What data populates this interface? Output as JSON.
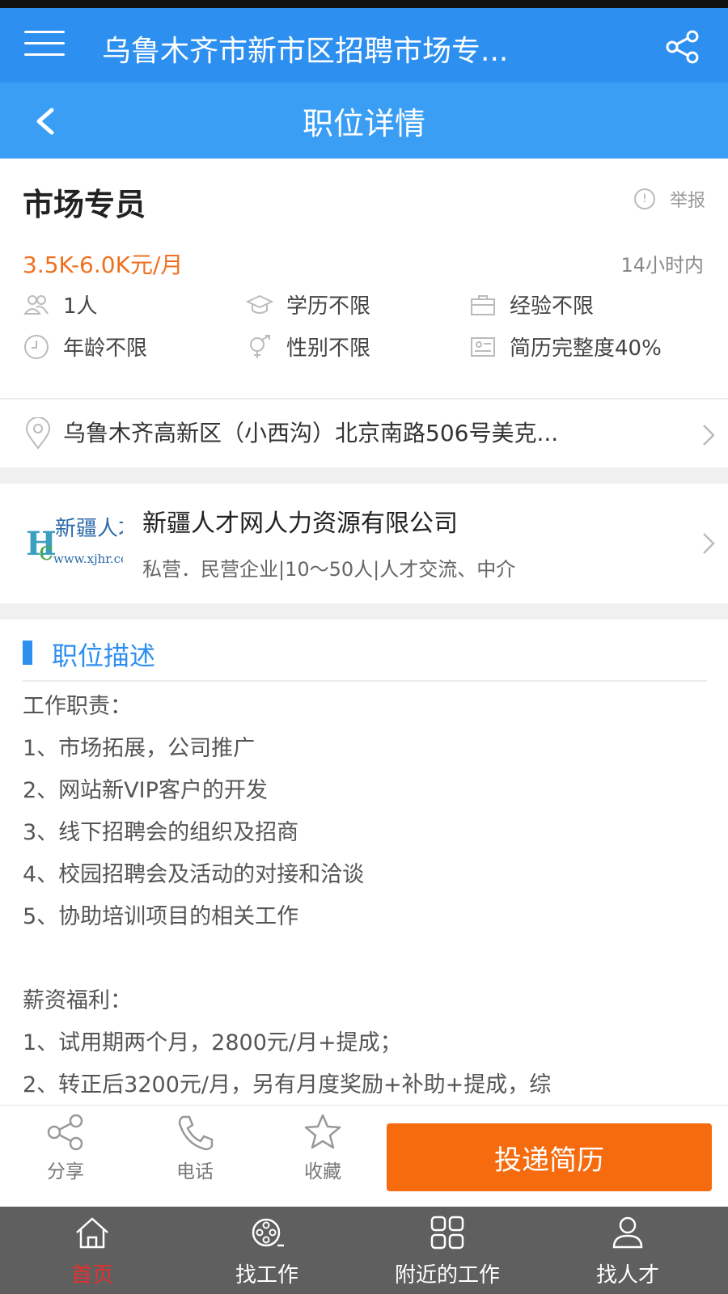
{
  "header": {
    "title": "乌鲁木齐市新市区招聘市场专...",
    "subtitle": "职位详情"
  },
  "job": {
    "title": "市场专员",
    "report_label": "举报",
    "salary": "3.5K-6.0K元/月",
    "posted": "14小时内",
    "attributes": [
      {
        "icon": "people-icon",
        "label": "1人"
      },
      {
        "icon": "graduation-cap-icon",
        "label": "学历不限"
      },
      {
        "icon": "briefcase-icon",
        "label": "经验不限"
      },
      {
        "icon": "clock-icon",
        "label": "年龄不限"
      },
      {
        "icon": "gender-icon",
        "label": "性别不限"
      },
      {
        "icon": "resume-card-icon",
        "label": "简历完整度40%"
      }
    ],
    "address": "乌鲁木齐高新区（小西沟）北京南路506号美克..."
  },
  "company": {
    "name": "新疆人才网人力资源有限公司",
    "info": "私营．民营企业|10～50人|人才交流、中介",
    "logo_text": "新疆人才网",
    "logo_url_text": "www.xjhr.com"
  },
  "description": {
    "heading": "职位描述",
    "lines": [
      "工作职责：",
      "1、市场拓展，公司推广",
      "2、网站新VIP客户的开发",
      "3、线下招聘会的组织及招商",
      "4、校园招聘会及活动的对接和洽谈",
      "5、协助培训项目的相关工作",
      "",
      "薪资福利：",
      "1、试用期两个月，2800元/月+提成；",
      "2、转正后3200元/月，另有月度奖励+补助+提成，综"
    ]
  },
  "actions": {
    "share": "分享",
    "phone": "电话",
    "favorite": "收藏",
    "apply": "投递简历"
  },
  "tabs": [
    {
      "label": "首页",
      "icon": "home-icon",
      "active": true
    },
    {
      "label": "找工作",
      "icon": "film-reel-icon",
      "active": false
    },
    {
      "label": "附近的工作",
      "icon": "grid-icon",
      "active": false
    },
    {
      "label": "找人才",
      "icon": "person-icon",
      "active": false
    }
  ],
  "colors": {
    "appbar": "#2d8ff0",
    "salary": "#f07020",
    "apply_button": "#f66b0e",
    "tabbar": "#5f5f5f",
    "active_tab": "#e53030"
  }
}
